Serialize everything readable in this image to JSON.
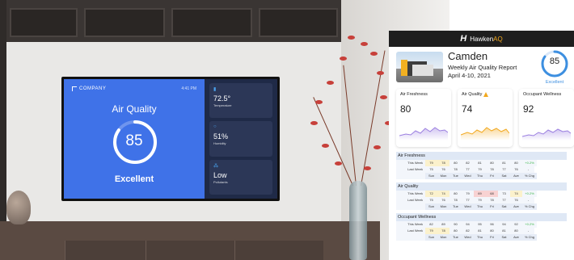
{
  "tv": {
    "company": "COMPANY",
    "time": "4:41 PM",
    "title": "Air Quality",
    "score": "85",
    "score_fraction": 0.85,
    "rating": "Excellent",
    "cards": [
      {
        "icon": "thermometer-icon",
        "value": "72.5°",
        "label": "Temperature"
      },
      {
        "icon": "humidity-icon",
        "value": "51%",
        "label": "Humidity"
      },
      {
        "icon": "pollutants-icon",
        "value": "Low",
        "label": "Pollutants"
      }
    ]
  },
  "report": {
    "brand_prefix": "Hawken",
    "brand_suffix": "AQ",
    "city": "Camden",
    "subtitle": "Weekly Air Quality Report",
    "date_range": "April 4-10, 2021",
    "score": "85",
    "score_fraction": 0.85,
    "rating": "Excellent",
    "cards": [
      {
        "label": "Air Freshness",
        "value": "80",
        "color": "#9b7fe0",
        "warning": false
      },
      {
        "label": "Air Quality",
        "value": "74",
        "color": "#f2a81d",
        "warning": true
      },
      {
        "label": "Occupant Wellness",
        "value": "92",
        "color": "#9b7fe0",
        "warning": false
      }
    ],
    "days": [
      "Sun",
      "Mon",
      "Tue",
      "Wed",
      "Thu",
      "Fri",
      "Sat",
      "Ave",
      "% Chg"
    ],
    "sections": [
      {
        "title": "Air Freshness",
        "rows": [
          {
            "label": "This Week",
            "values": [
              "79",
              "78",
              "80",
              "82",
              "81",
              "80",
              "81",
              "80",
              "+0.2%"
            ]
          },
          {
            "label": "Last Week",
            "values": [
              "75",
              "76",
              "78",
              "77",
              "79",
              "78",
              "77",
              "76",
              "-"
            ]
          }
        ]
      },
      {
        "title": "Air Quality",
        "rows": [
          {
            "label": "This Week",
            "values": [
              "72",
              "74",
              "80",
              "79",
              "69",
              "68",
              "73",
              "74",
              "+0.2%"
            ]
          },
          {
            "label": "Last Week",
            "values": [
              "75",
              "76",
              "78",
              "77",
              "79",
              "78",
              "77",
              "76",
              "-"
            ]
          }
        ]
      },
      {
        "title": "Occupant Wellness",
        "rows": [
          {
            "label": "This Week",
            "values": [
              "82",
              "89",
              "90",
              "94",
              "95",
              "96",
              "94",
              "92",
              "+0.2%"
            ]
          },
          {
            "label": "Last Week",
            "values": [
              "79",
              "78",
              "80",
              "82",
              "81",
              "80",
              "81",
              "80",
              "-"
            ]
          }
        ]
      }
    ]
  }
}
